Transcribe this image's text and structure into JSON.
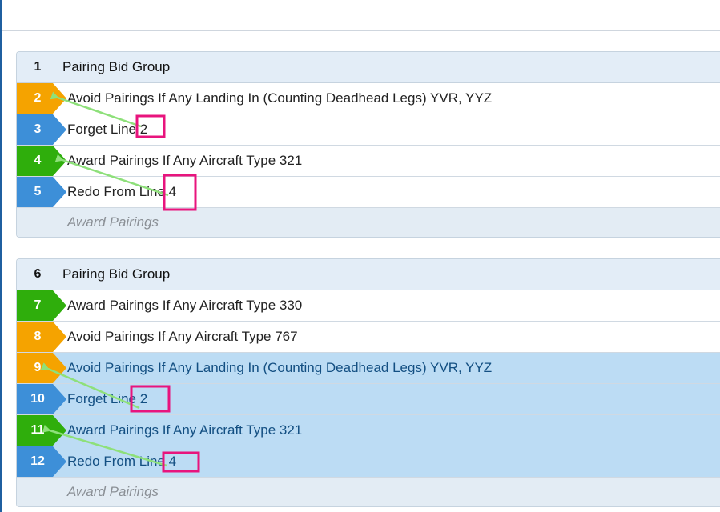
{
  "colors": {
    "orange": "#f5a300",
    "blue": "#3d8fd8",
    "green": "#2fae0c",
    "magenta": "#e8147d",
    "arrow": "#8ee07a"
  },
  "groups": [
    {
      "number": "1",
      "title": "Pairing Bid Group",
      "rows": [
        {
          "number": "2",
          "color": "orange",
          "text": "Avoid Pairings If Any Landing In (Counting Deadhead Legs) YVR, YYZ",
          "selected": false
        },
        {
          "number": "3",
          "color": "blue",
          "text": "Forget Line 2",
          "selected": false
        },
        {
          "number": "4",
          "color": "green",
          "text": "Award Pairings If Any Aircraft Type 321",
          "selected": false
        },
        {
          "number": "5",
          "color": "blue",
          "text": "Redo From Line 4",
          "selected": false
        }
      ],
      "footer": "Award Pairings"
    },
    {
      "number": "6",
      "title": "Pairing Bid Group",
      "rows": [
        {
          "number": "7",
          "color": "green",
          "text": "Award Pairings If Any Aircraft Type 330",
          "selected": false
        },
        {
          "number": "8",
          "color": "orange",
          "text": "Avoid Pairings If Any Aircraft Type 767",
          "selected": false
        },
        {
          "number": "9",
          "color": "orange",
          "text": "Avoid Pairings If Any Landing In (Counting Deadhead Legs) YVR, YYZ",
          "selected": true
        },
        {
          "number": "10",
          "color": "blue",
          "text": "Forget Line 2",
          "selected": true
        },
        {
          "number": "11",
          "color": "green",
          "text": "Award Pairings If Any Aircraft Type 321",
          "selected": true
        },
        {
          "number": "12",
          "color": "blue",
          "text": "Redo From Line 4",
          "selected": true
        }
      ],
      "footer": "Award Pairings"
    }
  ]
}
